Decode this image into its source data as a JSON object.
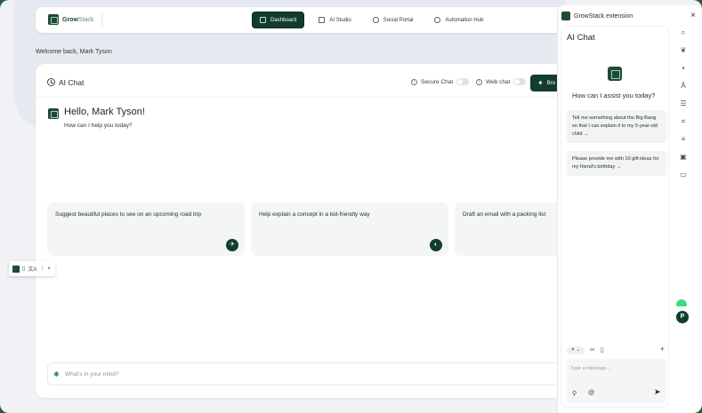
{
  "brand": {
    "name_bold": "Grow",
    "name_light": "Stack"
  },
  "nav": {
    "items": [
      {
        "label": "Dashboard",
        "icon": "dashboard-icon",
        "active": true
      },
      {
        "label": "AI Studio",
        "icon": "ai-studio-icon",
        "active": false
      },
      {
        "label": "Social Portal",
        "icon": "social-icon",
        "active": false
      },
      {
        "label": "Automation Hub",
        "icon": "automation-icon",
        "active": false
      }
    ]
  },
  "welcome": "Welcome back, Mark Tyson",
  "main": {
    "title": "AI Chat",
    "secure_chat_label": "Secure Chat",
    "web_chat_label": "Web chat",
    "browse_label": "Bro",
    "hello": "Hello, Mark Tyson!",
    "help": "How can I help you today?",
    "suggestions": [
      "Suggest beautiful places to see on an upcoming road trip",
      "Help explain a concept in a kid-friendly way",
      "Draft an email with a packing list"
    ],
    "input_placeholder": "What's in your mind?"
  },
  "mini_toolbar": {
    "translate_glyph": "文A",
    "close": "×",
    "more": "⋮"
  },
  "extension": {
    "title": "GrowStack extension",
    "close": "×",
    "chat_title": "AI Chat",
    "ask": "How can I assist you today?",
    "prompts": [
      "Tell me something about the Big Bang so that I can explain it to my 5-year-old child →",
      "Please provide me with 10 gift ideas for my friend's birthday →"
    ],
    "tool_dropdown": "✦ ⌄",
    "message_placeholder": "Type a message...",
    "avatar_letter": "P",
    "rail_icons": [
      "search-icon",
      "leaf-icon",
      "chat-icon",
      "translate-icon",
      "list-icon",
      "scan-icon",
      "checklist-icon",
      "image-icon",
      "folder-icon"
    ]
  },
  "colors": {
    "brand_dark": "#123d2c",
    "accent_green": "#3ddc84",
    "page_bg": "#f0f2f5"
  }
}
